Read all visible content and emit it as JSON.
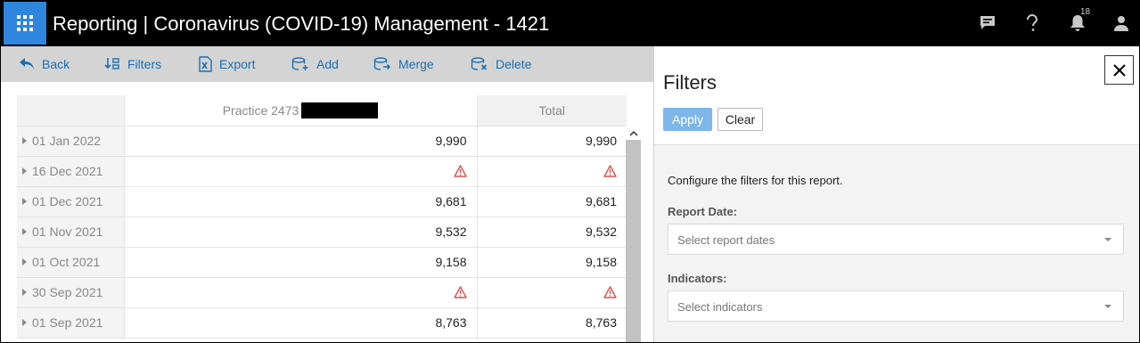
{
  "header": {
    "title": "Reporting | Coronavirus (COVID-19) Management - 1421",
    "notification_count": "18"
  },
  "toolbar": {
    "back": "Back",
    "filters": "Filters",
    "export": "Export",
    "add": "Add",
    "merge": "Merge",
    "delete": "Delete"
  },
  "grid": {
    "columns": [
      "",
      "Practice 2473",
      "Total"
    ],
    "rows": [
      {
        "date": "01 Jan 2022",
        "practice": "9,990",
        "total": "9,990",
        "warning": false
      },
      {
        "date": "16 Dec 2021",
        "practice": "",
        "total": "",
        "warning": true
      },
      {
        "date": "01 Dec 2021",
        "practice": "9,681",
        "total": "9,681",
        "warning": false
      },
      {
        "date": "01 Nov 2021",
        "practice": "9,532",
        "total": "9,532",
        "warning": false
      },
      {
        "date": "01 Oct 2021",
        "practice": "9,158",
        "total": "9,158",
        "warning": false
      },
      {
        "date": "30 Sep 2021",
        "practice": "",
        "total": "",
        "warning": true
      },
      {
        "date": "01 Sep 2021",
        "practice": "8,763",
        "total": "8,763",
        "warning": false
      }
    ]
  },
  "filters": {
    "title": "Filters",
    "apply": "Apply",
    "clear": "Clear",
    "description": "Configure the filters for this report.",
    "report_date_label": "Report Date:",
    "report_date_placeholder": "Select report dates",
    "indicators_label": "Indicators:",
    "indicators_placeholder": "Select indicators"
  },
  "colors": {
    "accent": "#2e86de",
    "link": "#1b6fb3",
    "warning": "#d9534f"
  }
}
